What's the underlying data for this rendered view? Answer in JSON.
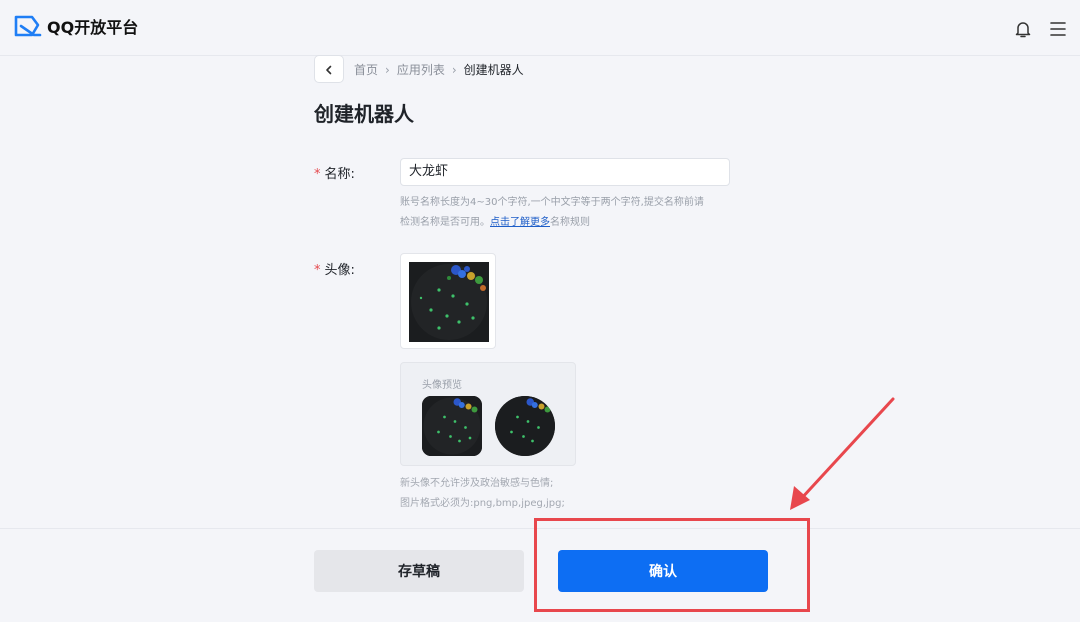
{
  "header": {
    "logo_text": "QQ开放平台",
    "icons": [
      "bell-icon",
      "menu-icon"
    ]
  },
  "breadcrumb": {
    "items": [
      "首页",
      "应用列表",
      "创建机器人"
    ]
  },
  "page_title": "创建机器人",
  "form": {
    "name_label": "名称:",
    "name_value": "大龙虾",
    "name_hint_line1": "账号名称长度为4~30个字符,一个中文字等于两个字符,提交名称前请",
    "name_hint_line2_prefix": "检测名称是否可用。",
    "name_hint_link": "点击了解更多",
    "name_hint_line2_suffix": "名称规则",
    "avatar_label": "头像:",
    "preview_title": "头像预览",
    "avatar_hint_line1": "新头像不允许涉及政治敏感与色情;",
    "avatar_hint_line2": "图片格式必须为:png,bmp,jpeg,jpg;"
  },
  "buttons": {
    "draft": "存草稿",
    "confirm": "确认"
  },
  "colors": {
    "primary": "#0d6ef3",
    "required": "#e5484d",
    "annotation": "#e8474d",
    "link": "#1e5ec8"
  }
}
